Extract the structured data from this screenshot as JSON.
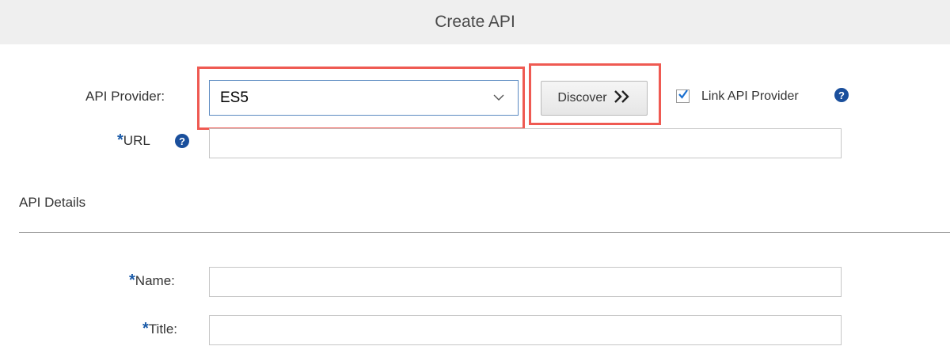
{
  "header": {
    "title": "Create API"
  },
  "form": {
    "provider": {
      "label": "API Provider:",
      "selected": "ES5",
      "discover_label": "Discover",
      "link_checked": true,
      "link_label": "Link API Provider"
    },
    "url": {
      "required_mark": "*",
      "label": "URL",
      "value": ""
    },
    "details": {
      "title": "API Details",
      "name": {
        "required_mark": "*",
        "label": "Name:",
        "value": ""
      },
      "title_field": {
        "required_mark": "*",
        "label": "Title:",
        "value": ""
      }
    }
  },
  "icons": {
    "help": "?",
    "chevron": "chevron-down-icon",
    "discover": "double-chevron-right-icon",
    "check": "checkmark-icon"
  },
  "colors": {
    "highlight": "#ef5a52",
    "accent": "#1a4f9c",
    "header_bg": "#efefef"
  }
}
